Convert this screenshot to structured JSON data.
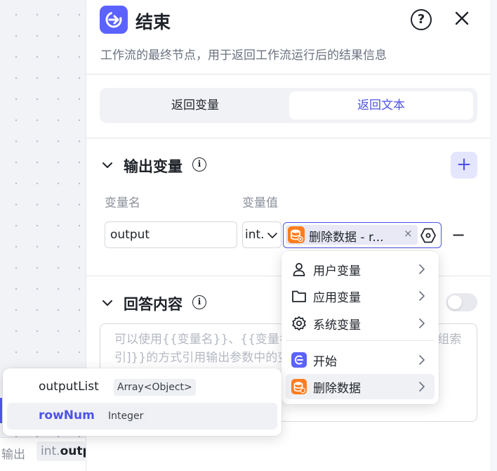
{
  "canvas": {
    "output_label": "输出",
    "output_chip_type": "int.",
    "output_chip_value": "outp"
  },
  "panel": {
    "title": "结束",
    "help_label": "?",
    "description": "工作流的最终节点，用于返回工作流运行后的结果信息",
    "tabs": [
      {
        "label": "返回变量",
        "active": false
      },
      {
        "label": "返回文本",
        "active": true
      }
    ]
  },
  "output_section": {
    "title": "输出变量",
    "add_label": "+",
    "col_name": "变量名",
    "col_value": "变量值",
    "row": {
      "name": "output",
      "type": "int.",
      "ref": "删除数据 - r...",
      "ref_close": "×",
      "remove": "−"
    }
  },
  "answer_section": {
    "title": "回答内容",
    "placeholder": "可以使用{{变量名}}、{{变量名.子变量名}}、{{变量名[数组索引]}}的方式引用输出参数中的变量"
  },
  "dropdown": {
    "items": [
      {
        "label": "用户变量",
        "icon": "user-icon"
      },
      {
        "label": "应用变量",
        "icon": "folder-icon"
      },
      {
        "label": "系统变量",
        "icon": "gear-icon"
      },
      {
        "label": "开始",
        "icon": "start-node-icon"
      },
      {
        "label": "删除数据",
        "icon": "database-icon",
        "active": true
      }
    ]
  },
  "popup": {
    "items": [
      {
        "name": "outputList",
        "type": "Array<Object>"
      },
      {
        "name": "rowNum",
        "type": "Integer",
        "active": true
      }
    ]
  },
  "colors": {
    "accent": "#4d53e8",
    "start_icon": "#5c62ff",
    "database_icon": "#ff7d1f"
  }
}
